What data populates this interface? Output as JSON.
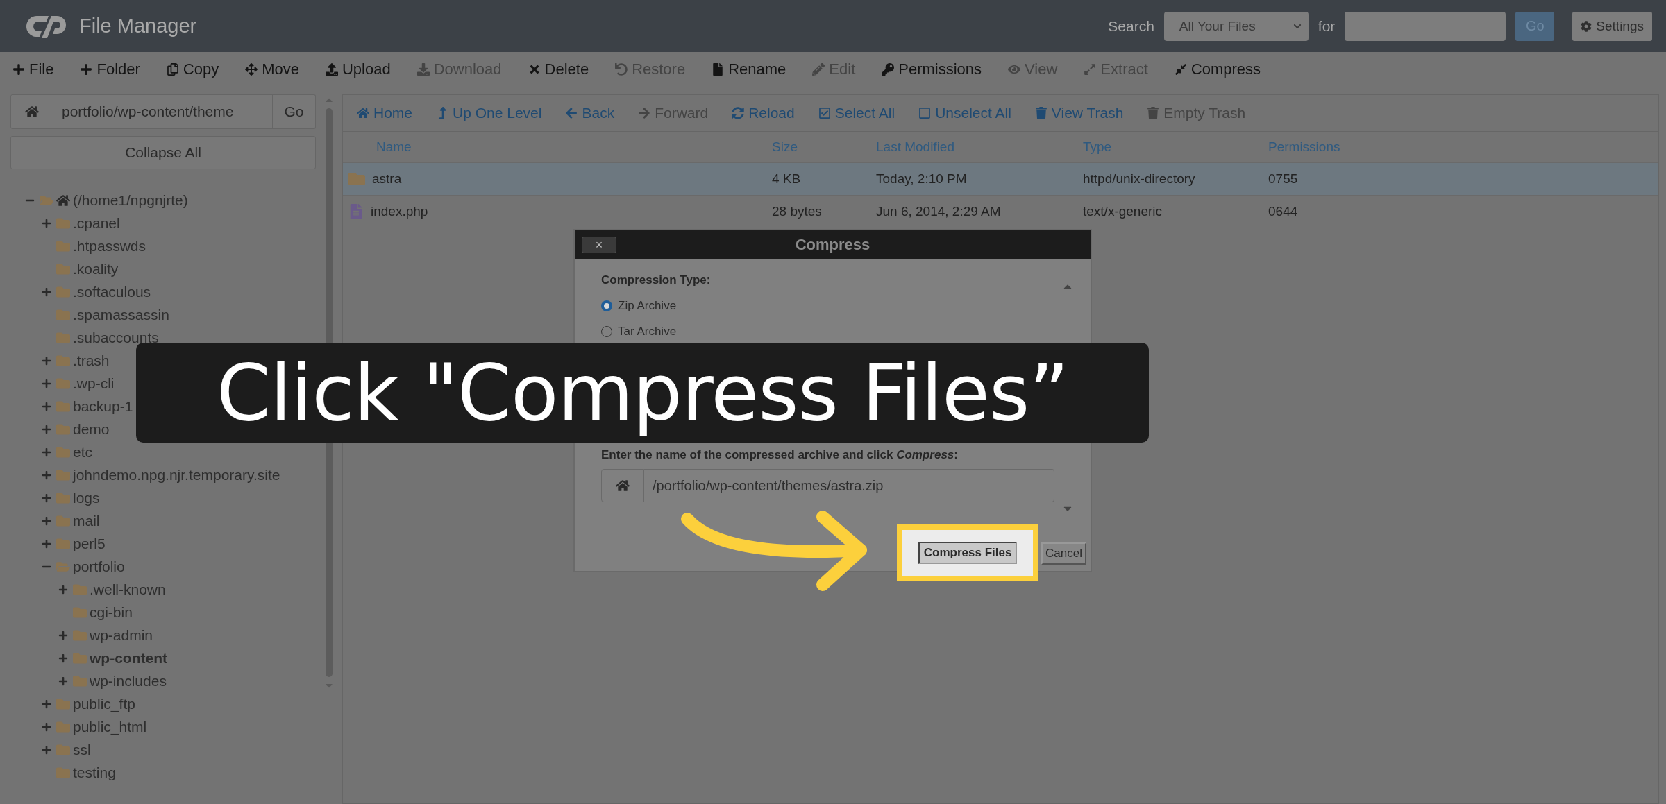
{
  "header": {
    "title": "File Manager",
    "search_label": "Search",
    "search_scope": "All Your Files",
    "for_label": "for",
    "go_button": "Go",
    "settings_button": "Settings"
  },
  "toolbar": [
    {
      "label": "File",
      "disabled": false
    },
    {
      "label": "Folder",
      "disabled": false
    },
    {
      "label": "Copy",
      "disabled": false
    },
    {
      "label": "Move",
      "disabled": false
    },
    {
      "label": "Upload",
      "disabled": false
    },
    {
      "label": "Download",
      "disabled": true
    },
    {
      "label": "Delete",
      "disabled": false
    },
    {
      "label": "Restore",
      "disabled": true
    },
    {
      "label": "Rename",
      "disabled": false
    },
    {
      "label": "Edit",
      "disabled": true
    },
    {
      "label": "Permissions",
      "disabled": false
    },
    {
      "label": "View",
      "disabled": true
    },
    {
      "label": "Extract",
      "disabled": true
    },
    {
      "label": "Compress",
      "disabled": false
    }
  ],
  "sidebar": {
    "path": "portfolio/wp-content/theme",
    "go_button": "Go",
    "collapse_button": "Collapse All",
    "tree": [
      {
        "name": "(/home1/npgnjrte)",
        "kind": "home",
        "expanded": true,
        "selected": false,
        "children": [
          {
            "name": ".cpanel",
            "expanded": false,
            "selected": false
          },
          {
            "name": ".htpasswds",
            "selected": false
          },
          {
            "name": ".koality",
            "selected": false
          },
          {
            "name": ".softaculous",
            "expanded": false,
            "selected": false
          },
          {
            "name": ".spamassassin",
            "selected": false
          },
          {
            "name": ".subaccounts",
            "selected": false
          },
          {
            "name": ".trash",
            "expanded": false,
            "selected": false
          },
          {
            "name": ".wp-cli",
            "expanded": false,
            "selected": false
          },
          {
            "name": "backup-1",
            "expanded": false,
            "selected": false
          },
          {
            "name": "demo",
            "expanded": false,
            "selected": false
          },
          {
            "name": "etc",
            "expanded": false,
            "selected": false
          },
          {
            "name": "johndemo.npg.njr.temporary.site",
            "expanded": false,
            "selected": false
          },
          {
            "name": "logs",
            "expanded": false,
            "selected": false
          },
          {
            "name": "mail",
            "expanded": false,
            "selected": false
          },
          {
            "name": "perl5",
            "expanded": false,
            "selected": false
          },
          {
            "name": "portfolio",
            "expanded": true,
            "selected": false,
            "children": [
              {
                "name": ".well-known",
                "expanded": false,
                "selected": false
              },
              {
                "name": "cgi-bin",
                "selected": false
              },
              {
                "name": "wp-admin",
                "expanded": false,
                "selected": false
              },
              {
                "name": "wp-content",
                "expanded": false,
                "selected": true
              },
              {
                "name": "wp-includes",
                "expanded": false,
                "selected": false
              }
            ]
          },
          {
            "name": "public_ftp",
            "expanded": false,
            "selected": false
          },
          {
            "name": "public_html",
            "expanded": false,
            "selected": false
          },
          {
            "name": "ssl",
            "expanded": false,
            "selected": false
          },
          {
            "name": "testing",
            "selected": false
          }
        ]
      }
    ]
  },
  "navbar": [
    {
      "label": "Home",
      "disabled": false
    },
    {
      "label": "Up One Level",
      "disabled": false
    },
    {
      "label": "Back",
      "disabled": false
    },
    {
      "label": "Forward",
      "disabled": true
    },
    {
      "label": "Reload",
      "disabled": false
    },
    {
      "label": "Select All",
      "disabled": false
    },
    {
      "label": "Unselect All",
      "disabled": false
    },
    {
      "label": "View Trash",
      "disabled": false
    },
    {
      "label": "Empty Trash",
      "disabled": true
    }
  ],
  "table": {
    "columns": [
      "Name",
      "Size",
      "Last Modified",
      "Type",
      "Permissions"
    ],
    "rows": [
      {
        "kind": "folder",
        "selected": true,
        "cells": [
          "astra",
          "4 KB",
          "Today, 2:10 PM",
          "httpd/unix-directory",
          "0755"
        ]
      },
      {
        "kind": "file",
        "selected": false,
        "cells": [
          "index.php",
          "28 bytes",
          "Jun 6, 2014, 2:29 AM",
          "text/x-generic",
          "0644"
        ]
      }
    ]
  },
  "dialog": {
    "title": "Compress",
    "close": "×",
    "type_label": "Compression Type:",
    "options": [
      {
        "label": "Zip Archive",
        "selected": true
      },
      {
        "label": "Tar Archive",
        "selected": false
      }
    ],
    "prompt": "Enter the name of the compressed archive and click *Compress*:",
    "archive_name": "/portfolio/wp-content/themes/astra.zip",
    "buttons": [
      "Compress Files",
      "Cancel"
    ]
  },
  "caption": "Click \"Compress Files”"
}
